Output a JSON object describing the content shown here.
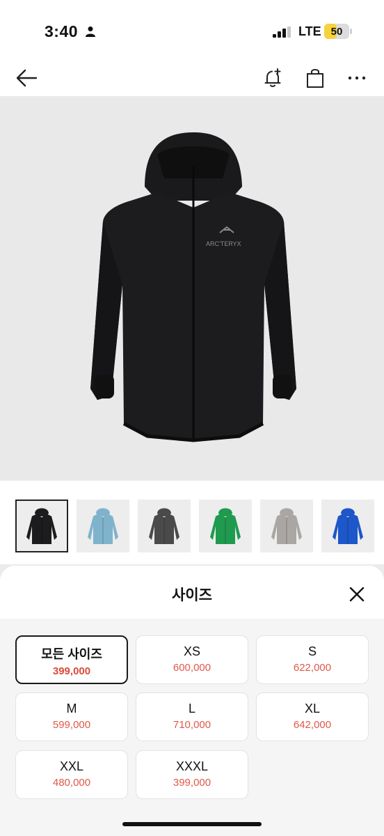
{
  "status_bar": {
    "time": "3:40",
    "network": "LTE",
    "battery": "50",
    "battery_level": 0.5
  },
  "nav": {
    "back_icon": "back-arrow-icon",
    "alert_icon": "bell-plus-icon",
    "bag_icon": "shopping-bag-icon",
    "more_icon": "more-dots-icon"
  },
  "gallery": {
    "thumbnails": [
      {
        "color": "#1c1c1e",
        "selected": true
      },
      {
        "color": "#7fb3cc"
      },
      {
        "color": "#4a4a4a"
      },
      {
        "color": "#1f9a4f"
      },
      {
        "color": "#a9a6a3"
      },
      {
        "color": "#1d57c9"
      }
    ]
  },
  "sheet": {
    "title": "사이즈",
    "close_icon": "close-icon",
    "options": [
      {
        "size": "모든 사이즈",
        "price": "399,000",
        "selected": true
      },
      {
        "size": "XS",
        "price": "600,000"
      },
      {
        "size": "S",
        "price": "622,000"
      },
      {
        "size": "M",
        "price": "599,000"
      },
      {
        "size": "L",
        "price": "710,000"
      },
      {
        "size": "XL",
        "price": "642,000"
      },
      {
        "size": "XXL",
        "price": "480,000"
      },
      {
        "size": "XXXL",
        "price": "399,000"
      }
    ]
  },
  "colors": {
    "accent_price": "#e0584a",
    "selected_border": "#1a1a1a"
  }
}
